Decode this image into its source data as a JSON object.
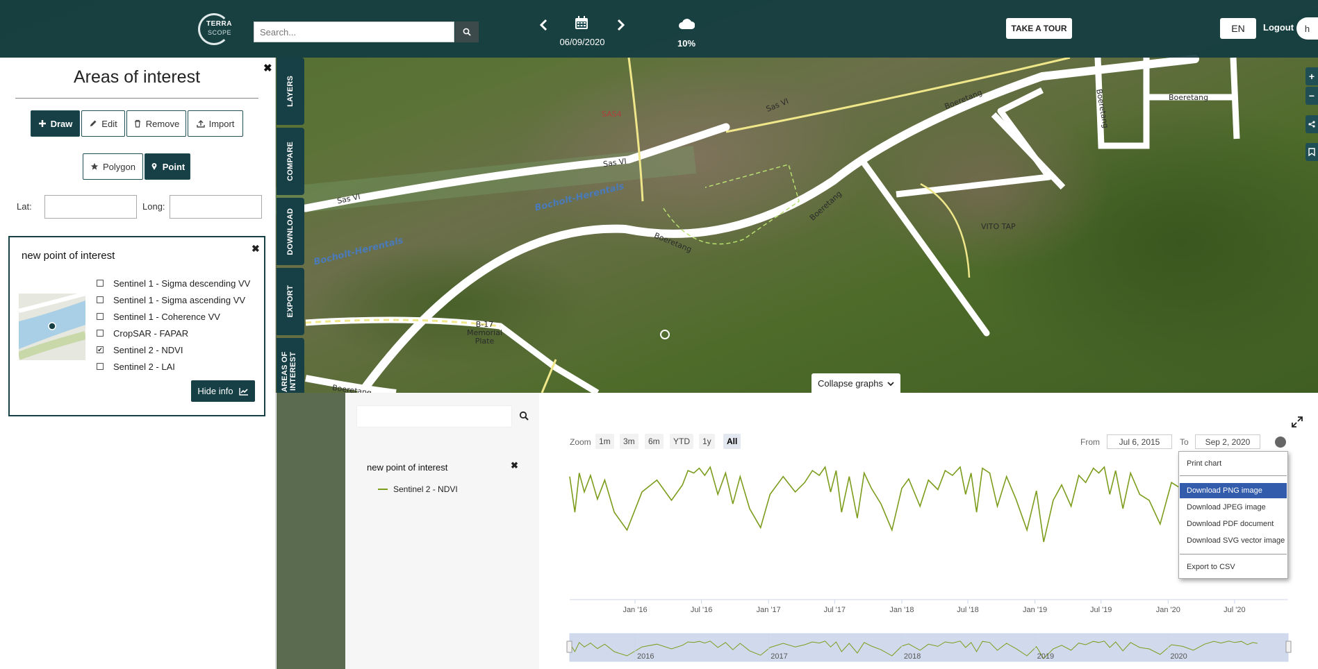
{
  "topbar": {
    "logo_line1": "TERRA",
    "logo_line2": "SCOPE",
    "search_placeholder": "Search...",
    "date": "06/09/2020",
    "cloud_cover": "10%",
    "tour_label": "TAKE A TOUR",
    "language": "EN",
    "logout_label": "Logout",
    "avatar_initial": "h"
  },
  "map": {
    "labels": [
      "Sas VI",
      "Sas VI",
      "Sas VI",
      "Boeretang",
      "Boeretang",
      "Boeretang",
      "Boeretang",
      "Boeretang",
      "Boeretang",
      "SAS4",
      "VITO TAP",
      "B-17 Memorial Plate"
    ],
    "water_labels": [
      "Bocholt-Herentals",
      "Bocholt-Herentals"
    ]
  },
  "left_panel": {
    "title": "Areas of interest",
    "buttons": {
      "draw": "Draw",
      "edit": "Edit",
      "remove": "Remove",
      "import": "Import"
    },
    "shape_buttons": {
      "polygon": "Polygon",
      "point": "Point"
    },
    "lat_label": "Lat:",
    "long_label": "Long:",
    "lat_value": "",
    "long_value": ""
  },
  "poi_card": {
    "title": "new point of interest",
    "layers": [
      {
        "label": "Sentinel 1 - Sigma descending VV",
        "checked": false
      },
      {
        "label": "Sentinel 1 - Sigma ascending VV",
        "checked": false
      },
      {
        "label": "Sentinel 1 - Coherence VV",
        "checked": false
      },
      {
        "label": "CropSAR - FAPAR",
        "checked": false
      },
      {
        "label": "Sentinel 2 - NDVI",
        "checked": true
      },
      {
        "label": "Sentinel 2 - LAI",
        "checked": false
      }
    ],
    "hide_info_label": "Hide info"
  },
  "side_tabs": [
    "LAYERS",
    "COMPARE",
    "DOWNLOAD",
    "EXPORT",
    "AREAS OF INTEREST"
  ],
  "graph": {
    "collapse_label": "Collapse graphs",
    "search_value": "",
    "group_title": "new point of interest",
    "series_label": "Sentinel 2 - NDVI",
    "zoom_label": "Zoom",
    "zoom_buttons": [
      "1m",
      "3m",
      "6m",
      "YTD",
      "1y",
      "All"
    ],
    "zoom_active": "All",
    "from_label": "From",
    "from_value": "Jul 6, 2015",
    "to_label": "To",
    "to_value": "Sep 2, 2020",
    "context_menu": {
      "print": "Print chart",
      "png": "Download PNG image",
      "jpeg": "Download JPEG image",
      "pdf": "Download PDF document",
      "svg": "Download SVG vector image",
      "csv": "Export to CSV"
    },
    "accent_color": "#7c9c1c",
    "highlight_color": "#335cad"
  },
  "chart_data": {
    "type": "line",
    "title": "",
    "xlabel": "",
    "ylabel": "",
    "x_tick_labels": [
      "Jan '16",
      "Jul '16",
      "Jan '17",
      "Jul '17",
      "Jan '18",
      "Jul '18",
      "Jan '19",
      "Jul '19",
      "Jan '20",
      "Jul '20"
    ],
    "navigator_labels": [
      "2016",
      "2017",
      "2018",
      "2019",
      "2020"
    ],
    "series": [
      {
        "name": "Sentinel 2 - NDVI",
        "color": "#7c9c1c",
        "x": [
          "2015-07-06",
          "2015-07-20",
          "2015-08-01",
          "2015-08-15",
          "2015-09-01",
          "2015-09-20",
          "2015-10-10",
          "2015-11-05",
          "2015-12-10",
          "2016-01-20",
          "2016-03-01",
          "2016-04-10",
          "2016-05-10",
          "2016-05-25",
          "2016-06-10",
          "2016-06-25",
          "2016-07-10",
          "2016-07-25",
          "2016-08-15",
          "2016-09-05",
          "2016-09-25",
          "2016-10-15",
          "2016-11-10",
          "2016-12-10",
          "2017-01-05",
          "2017-02-10",
          "2017-03-15",
          "2017-04-10",
          "2017-05-01",
          "2017-05-20",
          "2017-06-05",
          "2017-06-20",
          "2017-07-05",
          "2017-07-20",
          "2017-08-10",
          "2017-09-01",
          "2017-09-20",
          "2017-10-10",
          "2017-11-05",
          "2017-12-05",
          "2018-01-01",
          "2018-01-20",
          "2018-02-20",
          "2018-03-15",
          "2018-04-10",
          "2018-04-30",
          "2018-05-20",
          "2018-06-10",
          "2018-06-25",
          "2018-07-10",
          "2018-07-25",
          "2018-08-10",
          "2018-08-30",
          "2018-09-20",
          "2018-10-15",
          "2018-11-10",
          "2018-12-10",
          "2019-01-05",
          "2019-01-25",
          "2019-02-20",
          "2019-03-15",
          "2019-04-10",
          "2019-05-01",
          "2019-05-20",
          "2019-06-10",
          "2019-06-25",
          "2019-07-10",
          "2019-07-25",
          "2019-08-10",
          "2019-08-30",
          "2019-09-20",
          "2019-10-15",
          "2019-11-10",
          "2019-12-10",
          "2020-01-10",
          "2020-02-10",
          "2020-03-10",
          "2020-04-10",
          "2020-05-05",
          "2020-05-25",
          "2020-06-15",
          "2020-07-01",
          "2020-07-20",
          "2020-08-05",
          "2020-08-20",
          "2020-09-02"
        ],
        "y": [
          0.85,
          0.55,
          0.88,
          0.72,
          0.86,
          0.66,
          0.82,
          0.55,
          0.4,
          0.72,
          0.82,
          0.65,
          0.78,
          0.9,
          0.88,
          0.92,
          0.86,
          0.93,
          0.7,
          0.88,
          0.62,
          0.85,
          0.58,
          0.42,
          0.7,
          0.85,
          0.72,
          0.8,
          0.9,
          0.86,
          0.93,
          0.72,
          0.9,
          0.55,
          0.85,
          0.5,
          0.88,
          0.75,
          0.62,
          0.4,
          0.75,
          0.83,
          0.6,
          0.82,
          0.74,
          0.9,
          0.86,
          0.93,
          0.7,
          0.88,
          0.55,
          0.92,
          0.88,
          0.6,
          0.85,
          0.66,
          0.4,
          0.73,
          0.3,
          0.65,
          0.78,
          0.6,
          0.86,
          0.8,
          0.92,
          0.88,
          0.93,
          0.7,
          0.9,
          0.58,
          0.88,
          0.7,
          0.65,
          0.45,
          0.8,
          0.74,
          0.6,
          0.82,
          0.92,
          0.86,
          0.93,
          0.88,
          0.92,
          0.8,
          0.88,
          0.85
        ]
      }
    ],
    "xlim": [
      "2015-07-06",
      "2020-09-02"
    ],
    "ylim": [
      0.2,
      1.0
    ],
    "grid": false,
    "legend": "left-sidebar"
  }
}
